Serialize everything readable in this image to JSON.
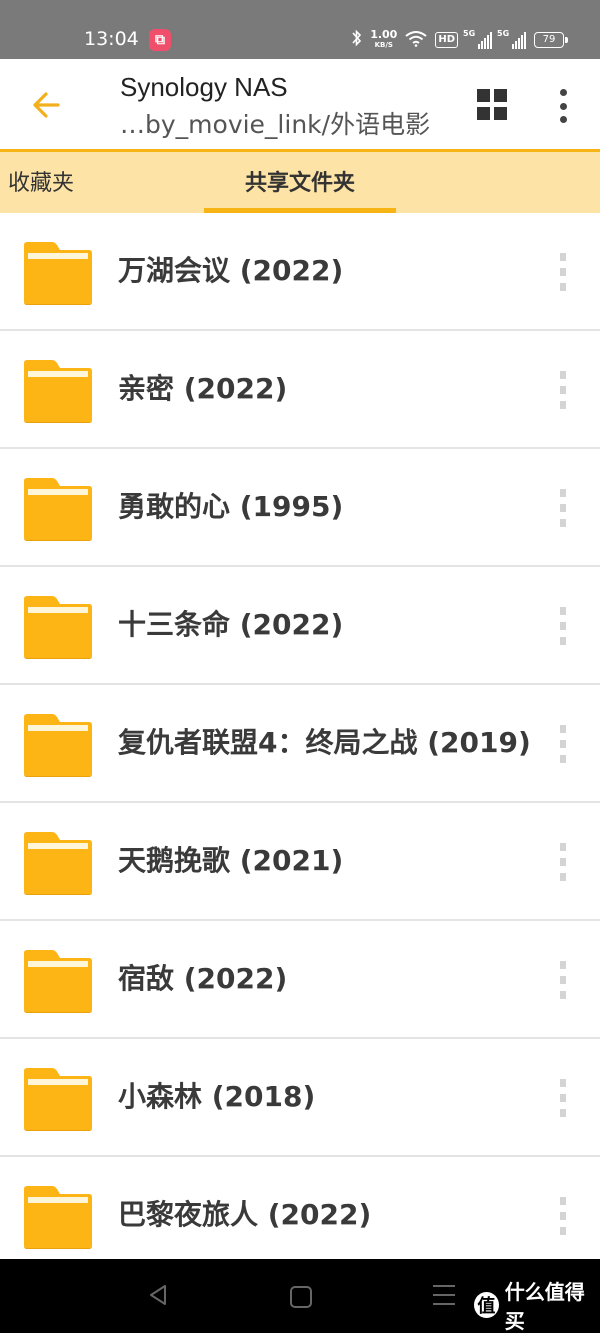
{
  "status_bar": {
    "time": "13:04",
    "speed_value": "1.00",
    "speed_unit": "KB/S",
    "hd_label": "HD",
    "sim1": "5G",
    "sim2": "5G",
    "battery": "79",
    "icons": [
      "app-notification-icon",
      "bluetooth-icon",
      "wifi-icon",
      "battery-icon"
    ]
  },
  "app_bar": {
    "title": "Synology NAS",
    "subtitle": "…by_movie_link/外语电影",
    "back_icon": "arrow-left-icon",
    "view_icon": "grid-view-icon",
    "more_icon": "more-vertical-icon"
  },
  "tabs": [
    {
      "label": "收藏夹",
      "active": false
    },
    {
      "label": "共享文件夹",
      "active": true
    }
  ],
  "folders": [
    {
      "name": "万湖会议 (2022)"
    },
    {
      "name": "亲密 (2022)"
    },
    {
      "name": "勇敢的心 (1995)"
    },
    {
      "name": "十三条命 (2022)"
    },
    {
      "name": "复仇者联盟4：终局之战 (2019)"
    },
    {
      "name": "天鹅挽歌 (2021)"
    },
    {
      "name": "宿敌 (2022)"
    },
    {
      "name": "小森林 (2018)"
    },
    {
      "name": "巴黎夜旅人 (2022)"
    }
  ],
  "nav_bar": {
    "watermark_badge": "值",
    "watermark_text": "什么值得买"
  },
  "colors": {
    "accent": "#f7b515",
    "folder": "#fdb515",
    "tab_bg": "#fde4a6",
    "status_bar": "#7a7a7a"
  }
}
